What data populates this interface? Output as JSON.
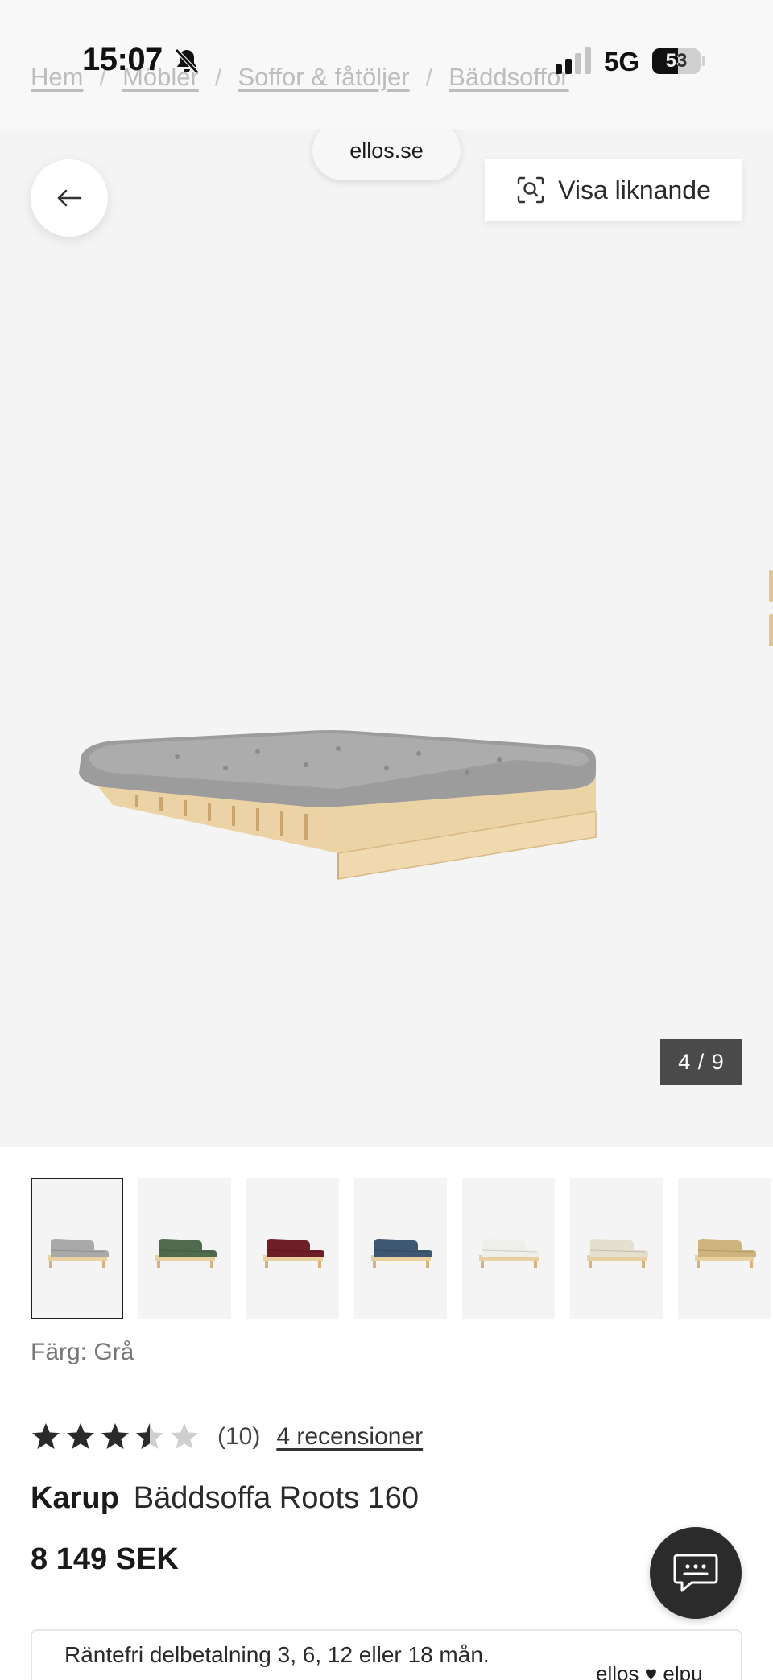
{
  "status": {
    "time": "15:07",
    "network": "5G",
    "battery": "53",
    "battery_level": 0.53
  },
  "breadcrumb": [
    {
      "label": "Hem"
    },
    {
      "label": "Möbler"
    },
    {
      "label": "Soffor & fåtöljer"
    },
    {
      "label": "Bäddsoffor"
    }
  ],
  "browser": {
    "url": "ellos.se"
  },
  "gallery": {
    "similar_label": "Visa liknande",
    "counter": "4 / 9"
  },
  "thumbnails": [
    {
      "color": "#a9a9a9",
      "selected": true
    },
    {
      "color": "#4f6a4c",
      "selected": false
    },
    {
      "color": "#6e1e26",
      "selected": false
    },
    {
      "color": "#3d5870",
      "selected": false
    },
    {
      "color": "#efefea",
      "selected": false
    },
    {
      "color": "#e4dfcf",
      "selected": false
    },
    {
      "color": "#cdb47d",
      "selected": false
    }
  ],
  "color_line": "Färg: Grå",
  "rating": {
    "value": 3.5,
    "max": 5,
    "count": "(10)",
    "reviews_label": "4 recensioner"
  },
  "product": {
    "brand": "Karup",
    "name": "Bäddsoffa Roots 160",
    "price": "8 149 SEK"
  },
  "finance": {
    "text": "Räntefri delbetalning 3, 6, 12 eller 18 mån.",
    "logo_left": "ellos",
    "logo_right": "elpu"
  },
  "icons": {
    "back": "arrow-left-icon",
    "similar": "visual-search-icon",
    "chat": "chat-bubble-icon",
    "bell": "bell-off-icon"
  }
}
